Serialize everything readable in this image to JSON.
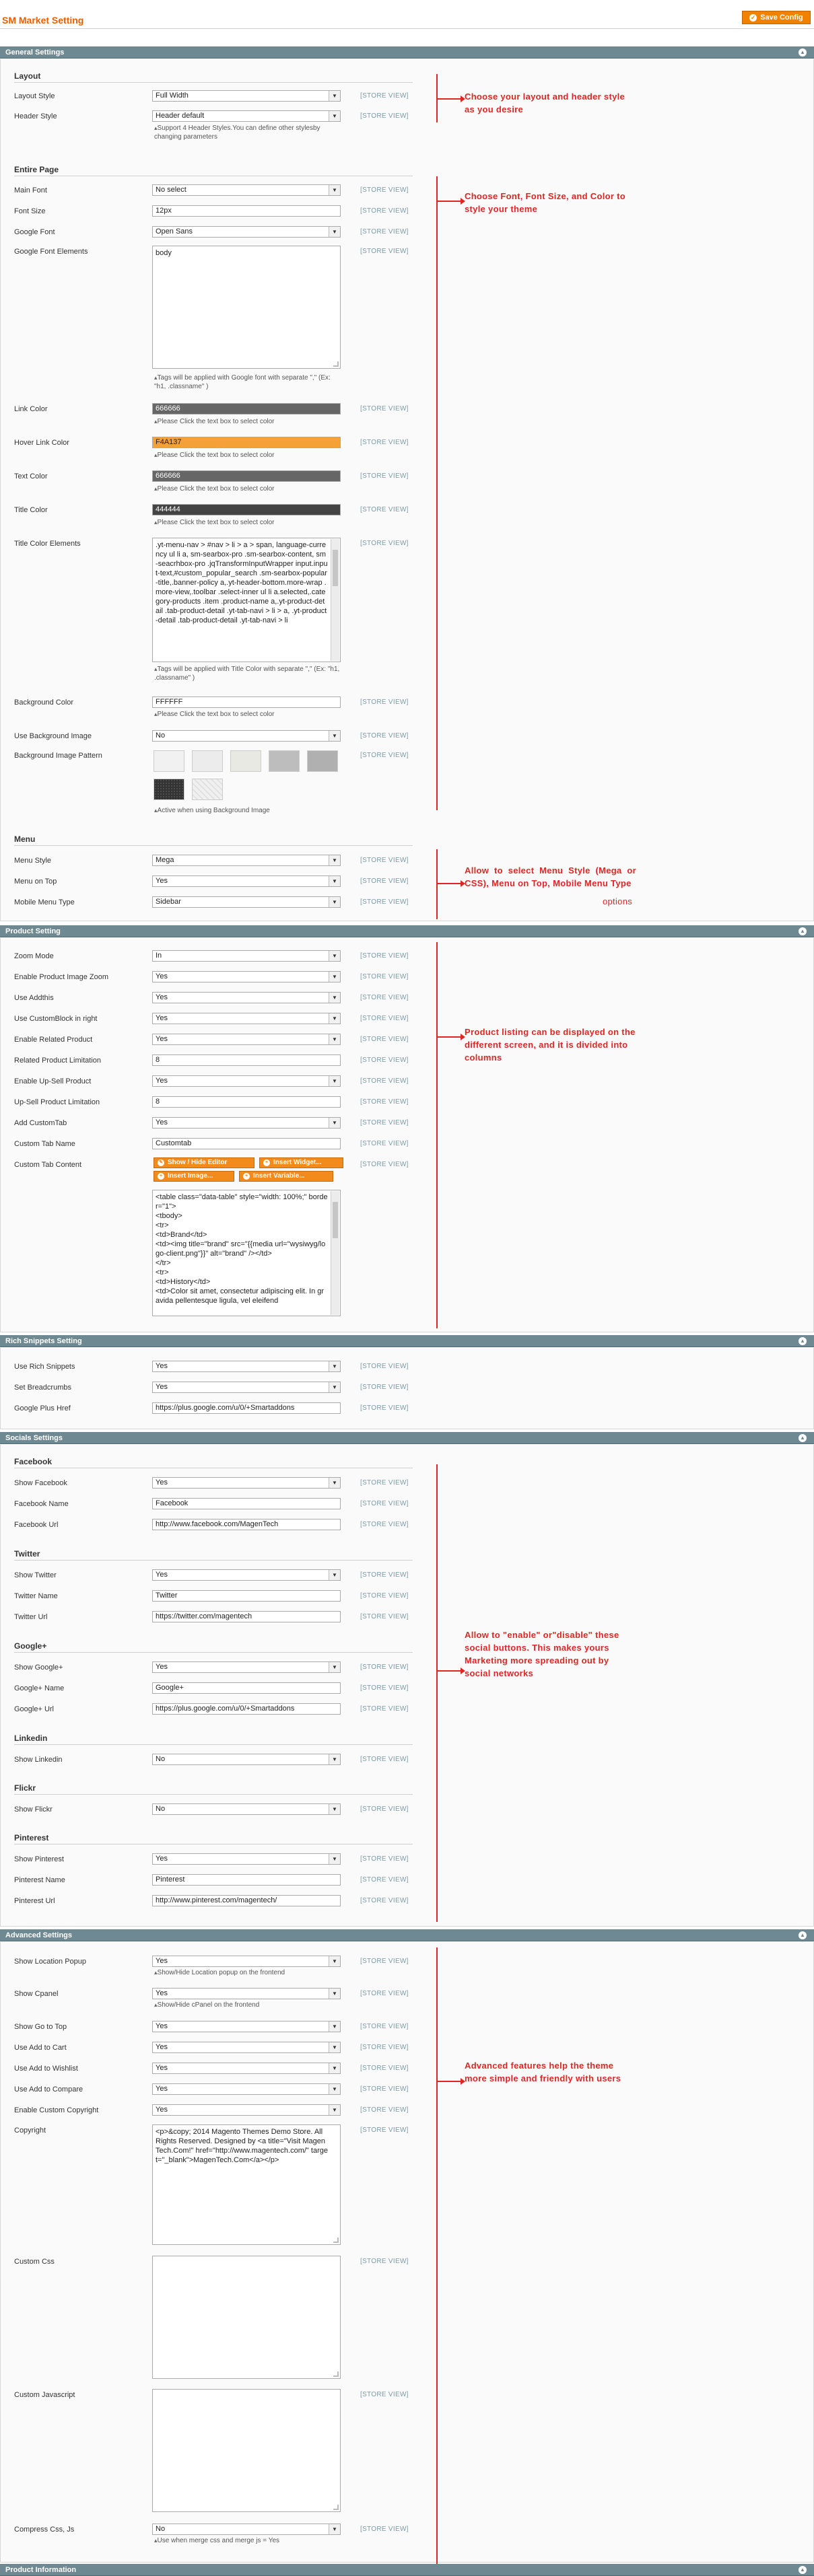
{
  "header": {
    "title": "SM Market Setting",
    "save_label": "Save Config",
    "save_icon": "save-icon"
  },
  "scope": "[STORE VIEW]",
  "sections": {
    "general": "General Settings",
    "product": "Product Setting",
    "rich": "Rich Snippets Setting",
    "socials": "Socials Settings",
    "advanced": "Advanced Settings",
    "info": "Product Information"
  },
  "layout": {
    "title": "Layout",
    "layout_style_label": "Layout Style",
    "layout_style_value": "Full Width",
    "header_style_label": "Header Style",
    "header_style_value": "Header default",
    "header_note": "Support 4 Header Styles.You can define other stylesby changing parameters"
  },
  "entire": {
    "title": "Entire Page",
    "main_font_label": "Main Font",
    "main_font_value": "No select",
    "font_size_label": "Font Size",
    "font_size_value": "12px",
    "google_font_label": "Google Font",
    "google_font_value": "Open Sans",
    "gfe_label": "Google Font Elements",
    "gfe_value": "body",
    "gfe_note": "Tags will be applied with Google font with separate \",\" (Ex: \"h1, .classname\" )",
    "link_color_label": "Link Color",
    "link_color_value": "666666",
    "hover_color_label": "Hover Link Color",
    "hover_color_value": "F4A137",
    "text_color_label": "Text Color",
    "text_color_value": "666666",
    "title_color_label": "Title Color",
    "title_color_value": "444444",
    "color_note": "Please Click the text box to select color",
    "tce_label": "Title Color Elements",
    "tce_value": ".yt-menu-nav > #nav > li > a > span, language-currency ul li a, sm-searbox-pro .sm-searbox-content, sm-seacrhbox-pro .jqTransformInputWrapper input.input-text,#custom_popular_search .sm-searbox-popular-title,.banner-policy a,.yt-header-bottom.more-wrap .more-view,.toolbar .select-inner ul li a.selected,.category-products .item .product-name a,.yt-product-detail .tab-product-detail .yt-tab-navi > li > a, .yt-product-detail .tab-product-detail .yt-tab-navi > li",
    "tce_note": "Tags will be applied with Title Color with separate \",\" (Ex: \"h1, .classname\" )",
    "bg_color_label": "Background Color",
    "bg_color_value": "FFFFFF",
    "use_bg_label": "Use Background Image",
    "use_bg_value": "No",
    "bg_pattern_label": "Background Image Pattern",
    "bg_pattern_note": "Active when using Background Image"
  },
  "menu": {
    "title": "Menu",
    "style_label": "Menu Style",
    "style_value": "Mega",
    "top_label": "Menu on Top",
    "top_value": "Yes",
    "mobile_label": "Mobile Menu Type",
    "mobile_value": "Sidebar"
  },
  "product": {
    "zoom_mode_label": "Zoom Mode",
    "zoom_mode_value": "In",
    "zoom_label": "Enable Product Image Zoom",
    "zoom_value": "Yes",
    "addthis_label": "Use Addthis",
    "addthis_value": "Yes",
    "custom_block_label": "Use CustomBlock in right",
    "custom_block_value": "Yes",
    "related_label": "Enable Related Product",
    "related_value": "Yes",
    "related_limit_label": "Related Product Limitation",
    "related_limit_value": "8",
    "upsell_label": "Enable Up-Sell Product",
    "upsell_value": "Yes",
    "upsell_limit_label": "Up-Sell Product Limitation",
    "upsell_limit_value": "8",
    "customtab_label": "Add CustomTab",
    "customtab_value": "Yes",
    "tabname_label": "Custom Tab Name",
    "tabname_value": "Customtab",
    "tabcontent_label": "Custom Tab Content",
    "btn_show": "Show / Hide Editor",
    "btn_widget": "Insert Widget...",
    "btn_image": "Insert Image...",
    "btn_variable": "Insert Variable...",
    "tabcontent_value": "<table class=\"data-table\" style=\"width: 100%;\" border=\"1\">\n<tbody>\n<tr>\n<td>Brand</td>\n<td><img title=\"brand\" src=\"{{media url=\"wysiwyg/logo-client.png\"}}\" alt=\"brand\" /></td>\n</tr>\n<tr>\n<td>History</td>\n<td>Color sit amet, consectetur adipiscing elit. In gravida pellentesque ligula, vel eleifend"
  },
  "rich": {
    "snippets_label": "Use Rich Snippets",
    "snippets_value": "Yes",
    "breadcrumbs_label": "Set Breadcrumbs",
    "breadcrumbs_value": "Yes",
    "gplus_label": "Google Plus Href",
    "gplus_value": "https://plus.google.com/u/0/+Smartaddons"
  },
  "socials": {
    "fb_title": "Facebook",
    "fb_show_label": "Show Facebook",
    "fb_show_value": "Yes",
    "fb_name_label": "Facebook Name",
    "fb_name_value": "Facebook",
    "fb_url_label": "Facebook Url",
    "fb_url_value": "http://www.facebook.com/MagenTech",
    "tw_title": "Twitter",
    "tw_show_label": "Show Twitter",
    "tw_show_value": "Yes",
    "tw_name_label": "Twitter Name",
    "tw_name_value": "Twitter",
    "tw_url_label": "Twitter Url",
    "tw_url_value": "https://twitter.com/magentech",
    "gp_title": "Google+",
    "gp_show_label": "Show Google+",
    "gp_show_value": "Yes",
    "gp_name_label": "Google+ Name",
    "gp_name_value": "Google+",
    "gp_url_label": "Google+ Url",
    "gp_url_value": "https://plus.google.com/u/0/+Smartaddons",
    "li_title": "Linkedin",
    "li_show_label": "Show Linkedin",
    "li_show_value": "No",
    "fl_title": "Flickr",
    "fl_show_label": "Show Flickr",
    "fl_show_value": "No",
    "pi_title": "Pinterest",
    "pi_show_label": "Show Pinterest",
    "pi_show_value": "Yes",
    "pi_name_label": "Pinterest Name",
    "pi_name_value": "Pinterest",
    "pi_url_label": "Pinterest Url",
    "pi_url_value": "http://www.pinterest.com/magentech/"
  },
  "advanced": {
    "location_label": "Show Location Popup",
    "location_value": "Yes",
    "location_note": "Show/Hide Location popup on the frontend",
    "cpanel_label": "Show Cpanel",
    "cpanel_value": "Yes",
    "cpanel_note": "Show/Hide cPanel on the frontend",
    "gotop_label": "Show Go to Top",
    "gotop_value": "Yes",
    "cart_label": "Use Add to Cart",
    "cart_value": "Yes",
    "wishlist_label": "Use Add to Wishlist",
    "wishlist_value": "Yes",
    "compare_label": "Use Add to Compare",
    "compare_value": "Yes",
    "copyright_en_label": "Enable Custom Copyright",
    "copyright_en_value": "Yes",
    "copyright_label": "Copyright",
    "copyright_value": "<p>&copy; 2014 Magento Themes Demo Store. All Rights Reserved. Designed by <a title=\"Visit MagenTech.Com!\" href=\"http://www.magentech.com/\" target=\"_blank\">MagenTech.Com</a></p>",
    "css_label": "Custom Css",
    "js_label": "Custom Javascript",
    "compress_label": "Compress Css, Js",
    "compress_value": "No",
    "compress_note": "Use when merge css and merge js = Yes"
  },
  "annotations": {
    "layout": "Choose your layout and header style as you desire",
    "entire": "Choose Font, Font Size, and Color to style your theme",
    "menu_1": "Allow to select Menu Style (Mega or CSS), Menu on Top, Mobile Menu Type",
    "menu_2": "options",
    "product": "Product listing can be displayed on the different screen, and it is divided into columns",
    "socials": "Allow to \"enable\" or\"disable\" these social buttons. This makes yours Marketing more spreading out by social networks",
    "advanced": "Advanced features help the theme more simple and friendly with users"
  },
  "colors": {
    "accent": "#f18200",
    "section": "#6f8992",
    "annotation": "#e02525",
    "link": "#666666",
    "hover": "#F4A137",
    "text": "#666666",
    "title": "#444444"
  },
  "swatches": [
    "#f1f1f1",
    "#ececec",
    "#e9e9e4",
    "#bdbdbd",
    "#b0b0b0",
    "#3a3a3a",
    "#f0f0f0"
  ]
}
